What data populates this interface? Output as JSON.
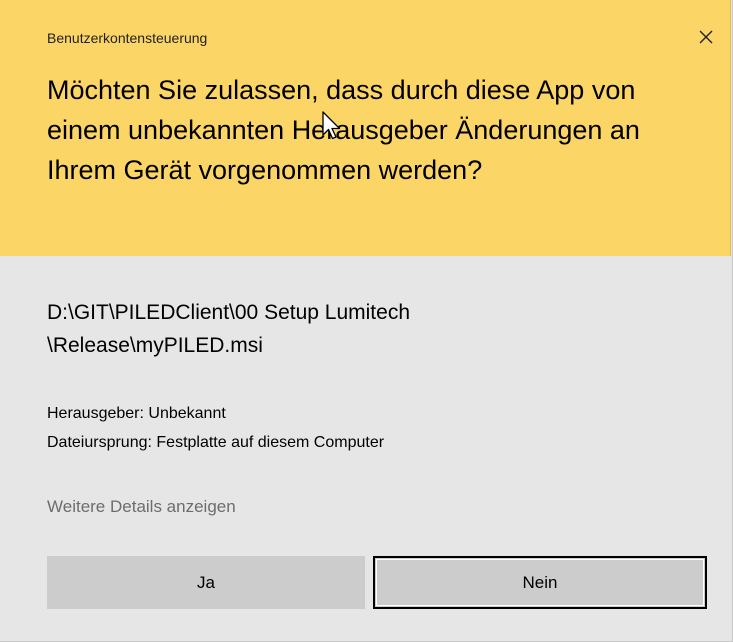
{
  "window": {
    "title": "Benutzerkontensteuerung",
    "close_icon": "close-icon"
  },
  "header": {
    "question": "Möchten Sie zulassen, dass durch diese App von einem unbekannten Herausgeber Änderungen an Ihrem Gerät vorgenommen werden?",
    "background_color": "#fcd567"
  },
  "program": {
    "path_line1": "D:\\GIT\\PILEDClient\\00 Setup Lumitech",
    "path_line2": "\\Release\\myPILED.msi",
    "publisher": "Herausgeber: Unbekannt",
    "origin": "Dateiursprung: Festplatte auf diesem Computer"
  },
  "details_link": "Weitere Details anzeigen",
  "buttons": {
    "yes_label": "Ja",
    "no_label": "Nein"
  }
}
